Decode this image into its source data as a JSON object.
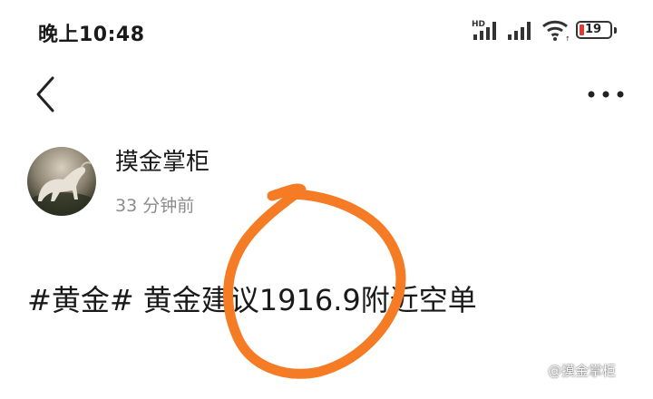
{
  "status_bar": {
    "time": "晚上10:48",
    "network_label": "HD",
    "battery_level": "19",
    "icons": [
      "hd-signal-icon",
      "signal-icon",
      "wifi-icon",
      "battery-icon"
    ]
  },
  "nav": {
    "back_icon": "chevron-left-icon",
    "more_icon": "more-dots-icon"
  },
  "post": {
    "author": "摸金掌柜",
    "time_ago": "33 分钟前",
    "content": "#黄金# 黄金建议1916.9附近空单"
  },
  "watermark": "@摸金掌柜",
  "colors": {
    "annotation": "#f57c24",
    "battery_low": "#e53935",
    "secondary_text": "#8c8c8c"
  }
}
